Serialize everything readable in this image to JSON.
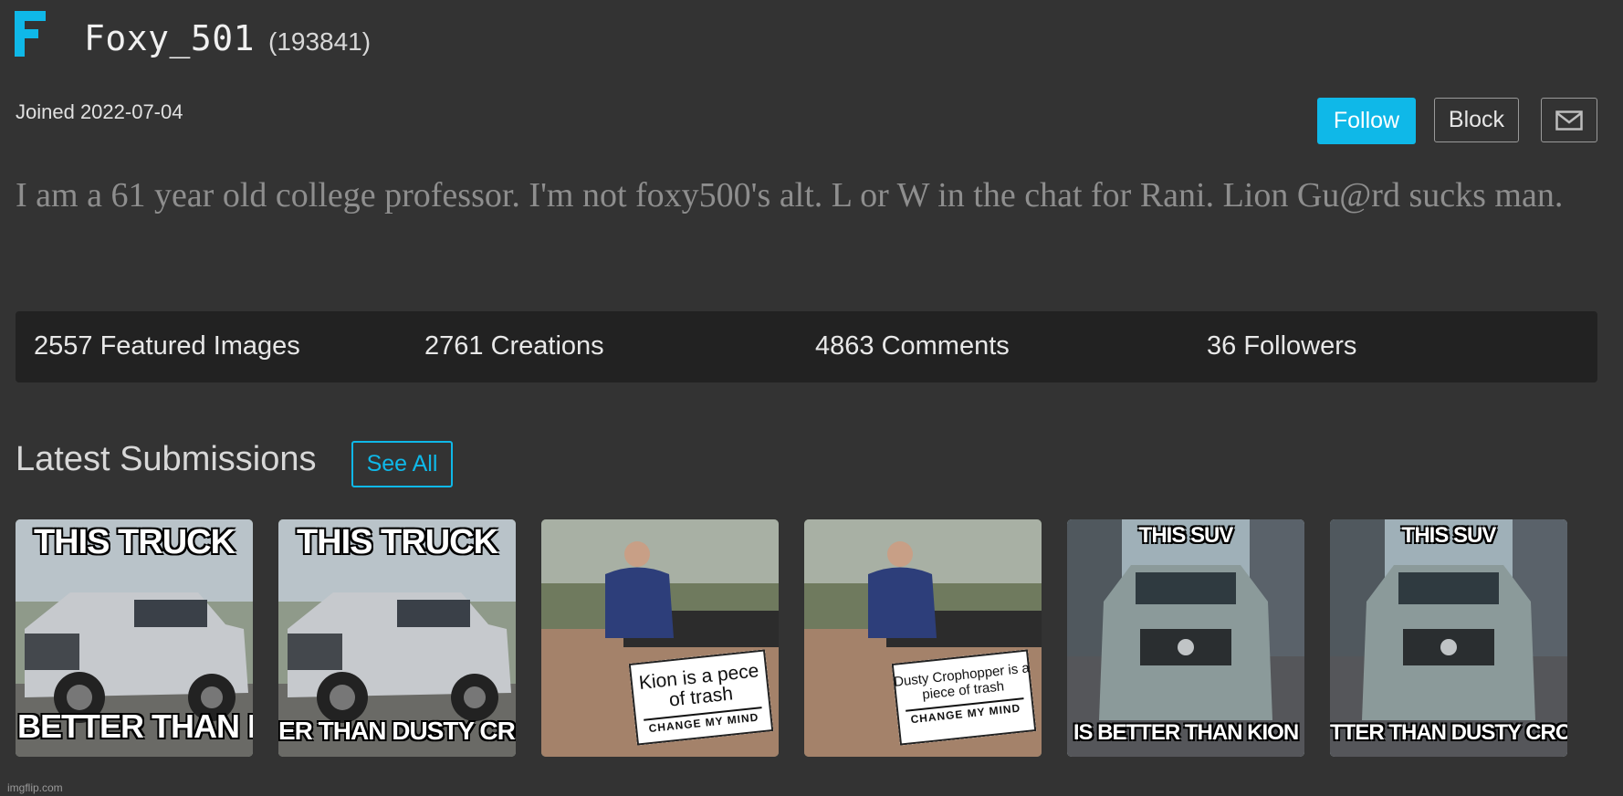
{
  "profile": {
    "avatar_letter": "F",
    "avatar_color": "#0fb8e8",
    "username": "Foxy_501",
    "points": "(193841)",
    "joined": "Joined 2022-07-04",
    "bio": "I am a 61 year old college professor. I'm not foxy500's alt. L or W in the chat for Rani. Lion Gu@rd sucks man."
  },
  "actions": {
    "follow_label": "Follow",
    "block_label": "Block",
    "message_icon": "mail-icon"
  },
  "stats": [
    {
      "label": "2557 Featured Images"
    },
    {
      "label": "2761 Creations"
    },
    {
      "label": "4863 Comments"
    },
    {
      "label": "36 Followers"
    }
  ],
  "submissions": {
    "title": "Latest Submissions",
    "see_all_label": "See All",
    "items": [
      {
        "kind": "truck",
        "top_caption": "THIS TRUCK",
        "bottom_caption": "BETTER THAN KI"
      },
      {
        "kind": "truck",
        "top_caption": "THIS TRUCK",
        "bottom_caption": "ER THAN DUSTY CROPI"
      },
      {
        "kind": "change-my-mind",
        "sign_text": "Kion is a pece of trash",
        "sign_footer": "CHANGE MY MIND"
      },
      {
        "kind": "change-my-mind",
        "sign_text": "Dusty Crophopper is a piece of trash",
        "sign_footer": "CHANGE MY MIND"
      },
      {
        "kind": "suv",
        "top_caption": "THIS SUV",
        "bottom_caption": "IS BETTER THAN KION"
      },
      {
        "kind": "suv",
        "top_caption": "THIS SUV",
        "bottom_caption": "TTER THAN DUSTY CROPHO"
      }
    ]
  },
  "footer": {
    "watermark": "imgflip.com"
  },
  "colors": {
    "background": "#333333",
    "accent": "#0fb8e8",
    "stats_bar": "#222222"
  }
}
